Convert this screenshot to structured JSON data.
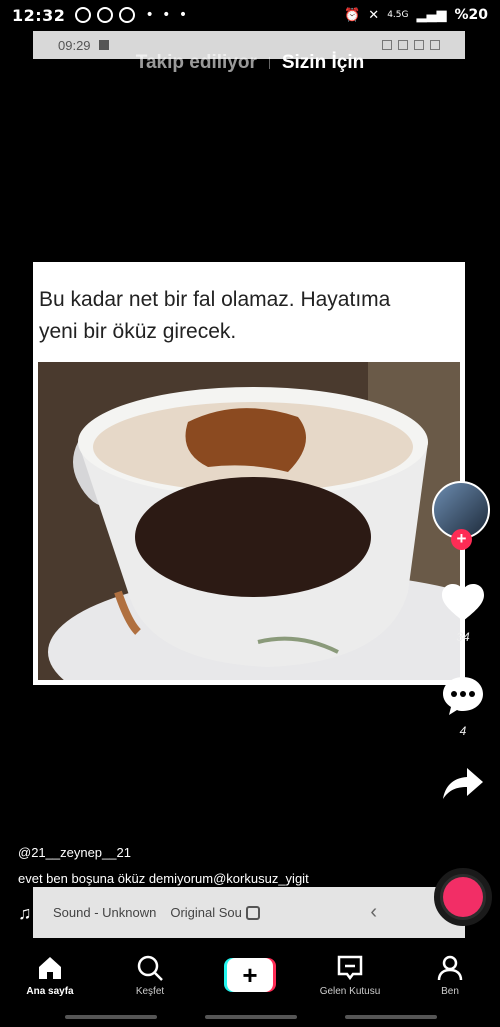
{
  "status_bar": {
    "time": "12:32",
    "network": "4.5G",
    "battery": "%20"
  },
  "inner_status": {
    "time": "09:29"
  },
  "top_tabs": {
    "following": "Takip ediliyor",
    "for_you": "Sizin İçin"
  },
  "post": {
    "caption_line1": "Bu kadar net bir fal olamaz. Hayatıma",
    "caption_line2": "yeni bir öküz girecek.",
    "username": "@21__zeynep__21",
    "description": "evet ben  boşuna öküz demiyorum@korkusuz_yigit",
    "music": {
      "sound": "Sound - Unknown",
      "original": "Original Sou"
    }
  },
  "actions": {
    "likes": "34",
    "comments": "4"
  },
  "bottom_nav": {
    "home": "Ana sayfa",
    "discover": "Keşfet",
    "inbox": "Gelen Kutusu",
    "me": "Ben"
  },
  "colors": {
    "accent": "#fe2c55",
    "cyan": "#25f4ee",
    "background": "#000000"
  }
}
